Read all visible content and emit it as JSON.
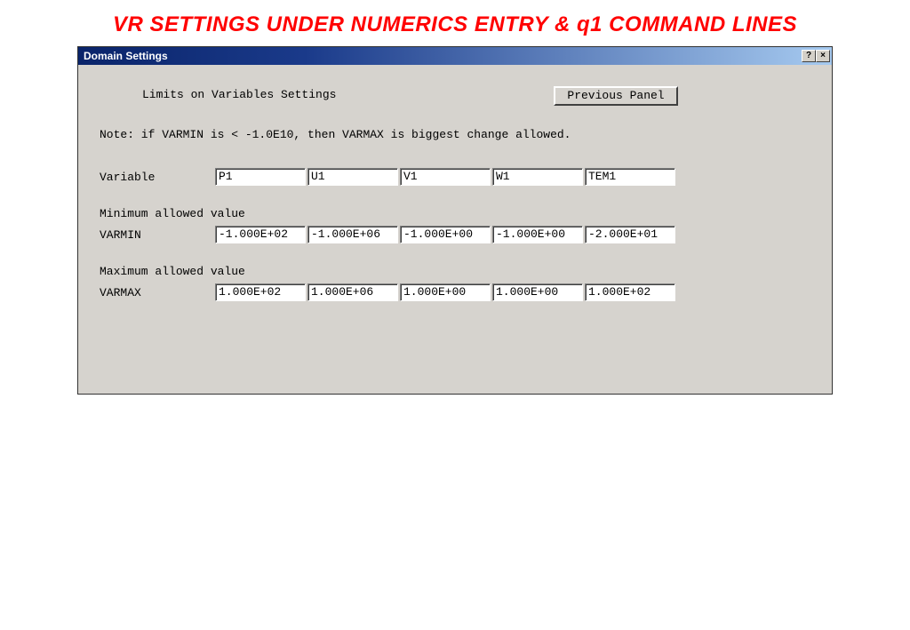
{
  "heading": "VR SETTINGS UNDER NUMERICS ENTRY  &  q1  COMMAND LINES",
  "window": {
    "title": "Domain Settings",
    "help_glyph": "?",
    "close_glyph": "×"
  },
  "panel": {
    "title": "Limits on Variables Settings",
    "prev_button": "Previous Panel",
    "note": "Note: if VARMIN is < -1.0E10, then VARMAX is biggest change allowed.",
    "variable_label": "Variable",
    "variables": [
      "P1",
      "U1",
      "V1",
      "W1",
      "TEM1"
    ],
    "min_section_label": "Minimum allowed value",
    "varmin_label": "VARMIN",
    "varmin": [
      "-1.000E+02",
      "-1.000E+06",
      "-1.000E+00",
      "-1.000E+00",
      "-2.000E+01"
    ],
    "max_section_label": "Maximum allowed value",
    "varmax_label": "VARMAX",
    "varmax": [
      "1.000E+02",
      "1.000E+06",
      "1.000E+00",
      "1.000E+00",
      "1.000E+02"
    ]
  }
}
